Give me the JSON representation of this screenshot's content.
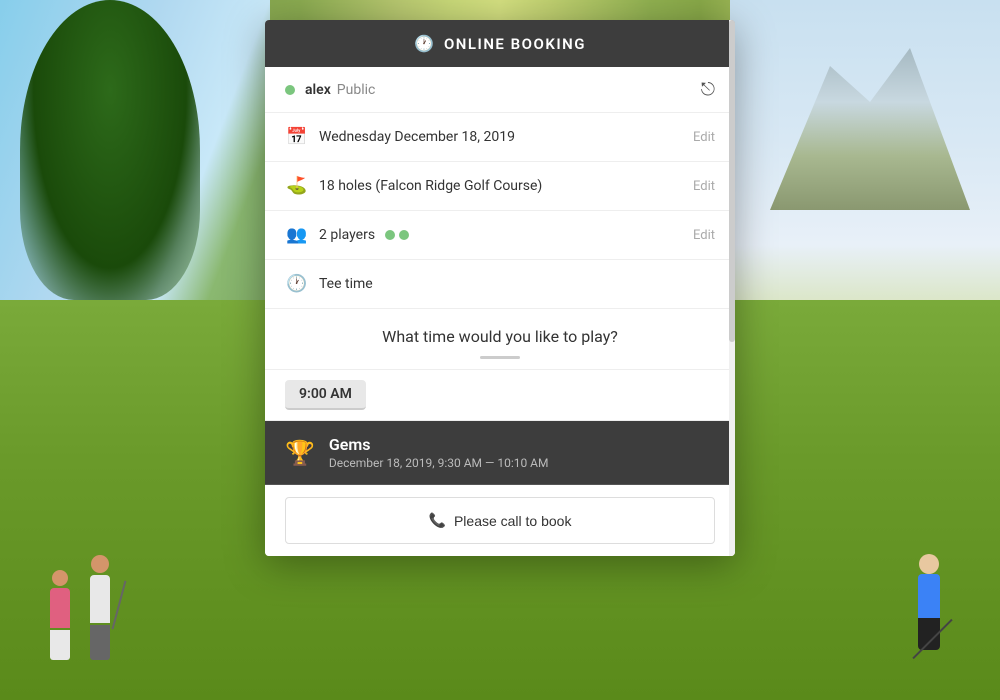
{
  "header": {
    "icon": "🕐",
    "title": "ONLINE BOOKING"
  },
  "user": {
    "name": "alex",
    "status": "Public",
    "dot_color": "#7bc67e"
  },
  "booking": {
    "date_icon": "📅",
    "date": "Wednesday December 18, 2019",
    "date_edit": "Edit",
    "holes_icon": "⛳",
    "holes": "18 holes (Falcon Ridge Golf Course)",
    "holes_edit": "Edit",
    "players_icon": "👥",
    "players": "2 players",
    "players_edit": "Edit",
    "tee_icon": "🕐",
    "tee_label": "Tee time"
  },
  "question": {
    "text": "What time would you like to play?"
  },
  "time_slot": {
    "time": "9:00 AM"
  },
  "tee_time_card": {
    "trophy_icon": "🏆",
    "title": "Gems",
    "date_range": "December 18, 2019, 9:30 AM — 10:10 AM"
  },
  "cta": {
    "phone_icon": "📞",
    "label": "Please call to book"
  },
  "colors": {
    "header_bg": "#3d3d3d",
    "accent_green": "#7bc67e",
    "text_dark": "#333333",
    "text_muted": "#aaaaaa",
    "border": "#eeeeee",
    "card_bg": "#3d3d3d"
  }
}
